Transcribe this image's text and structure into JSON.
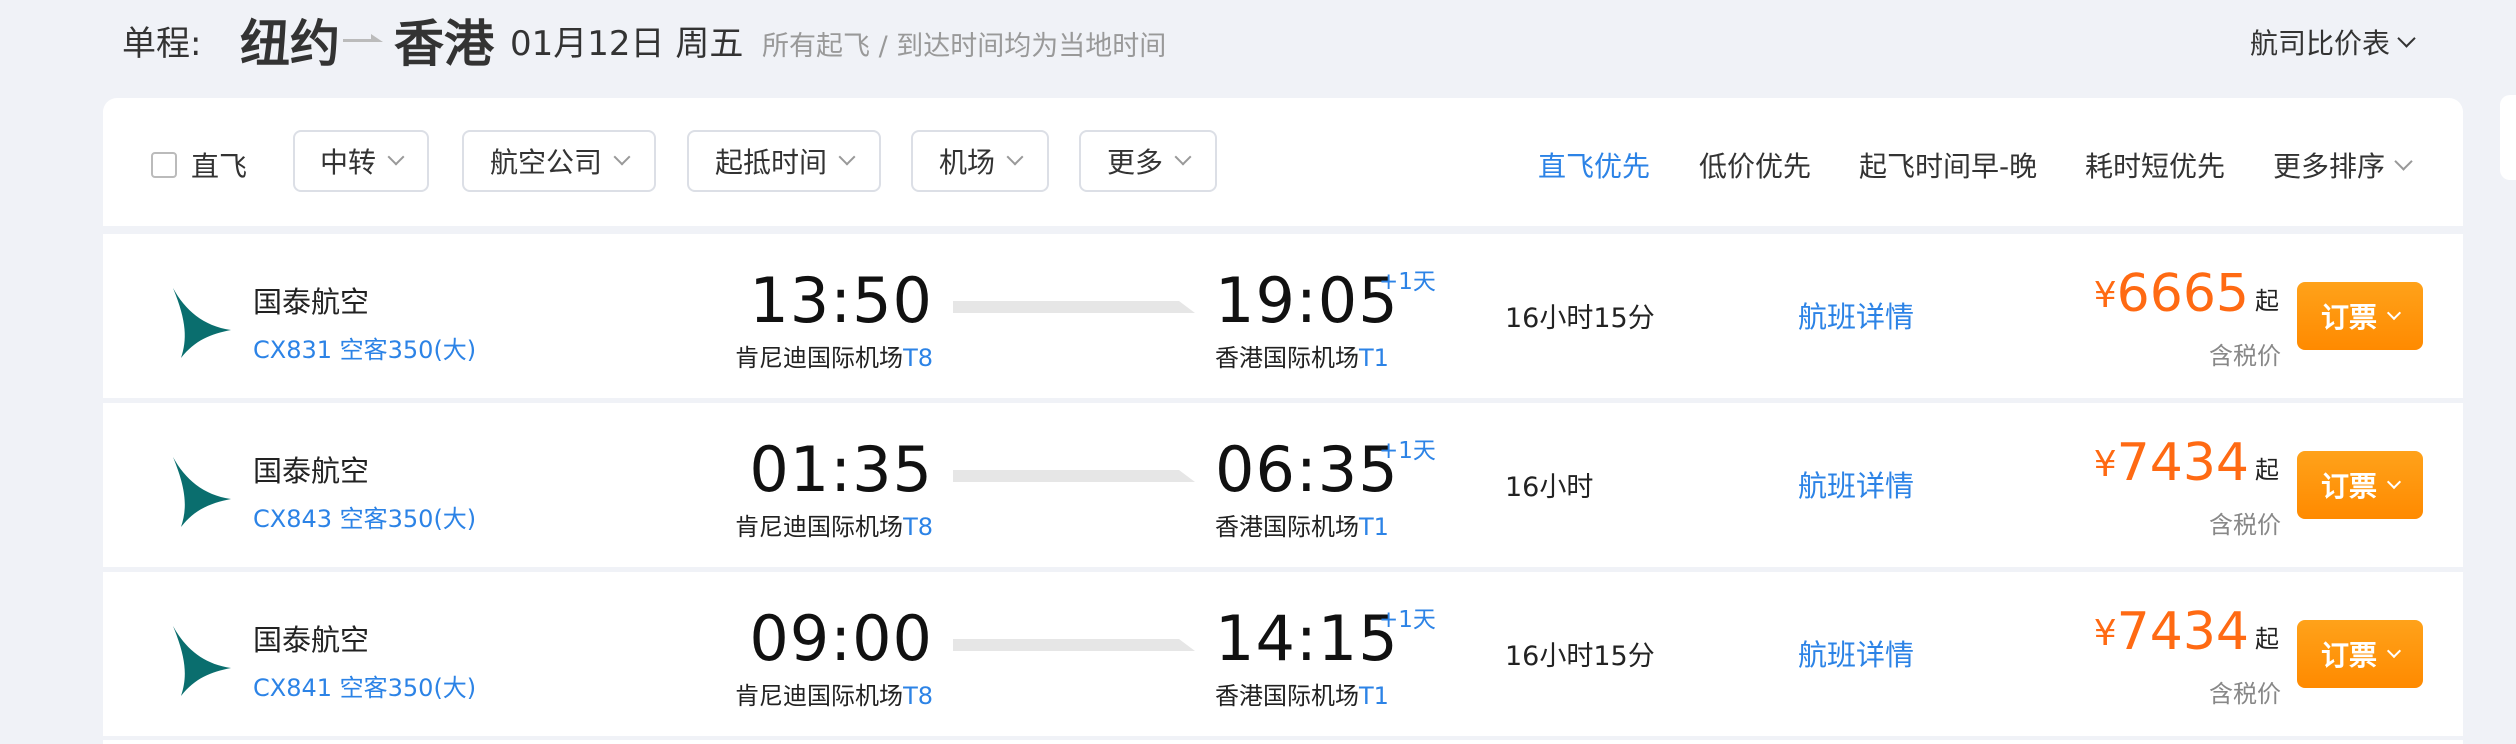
{
  "header": {
    "trip_type": "单程:",
    "from_city": "纽约",
    "to_city": "香港",
    "date": "01月12日 周五",
    "time_note": "所有起飞 / 到达时间均为当地时间",
    "compare_label": "航司比价表"
  },
  "filters": {
    "direct_label": "直飞",
    "direct_checked": false,
    "buttons": [
      "中转",
      "航空公司",
      "起抵时间",
      "机场",
      "更多"
    ]
  },
  "sort": {
    "options": [
      "直飞优先",
      "低价优先",
      "起飞时间早-晚",
      "耗时短优先",
      "更多排序"
    ],
    "active_index": 0
  },
  "flights": [
    {
      "airline": "国泰航空",
      "flight_info": "CX831 空客350(大)",
      "dep_time": "13:50",
      "dep_airport": "肯尼迪国际机场",
      "dep_terminal": "T8",
      "arr_time": "19:05",
      "arr_airport": "香港国际机场",
      "arr_terminal": "T1",
      "next_day": "+1天",
      "duration": "16小时15分",
      "detail_label": "航班详情",
      "currency": "¥",
      "price": "6665",
      "price_suffix": "起",
      "tax_label": "含税价",
      "book_label": "订票"
    },
    {
      "airline": "国泰航空",
      "flight_info": "CX843 空客350(大)",
      "dep_time": "01:35",
      "dep_airport": "肯尼迪国际机场",
      "dep_terminal": "T8",
      "arr_time": "06:35",
      "arr_airport": "香港国际机场",
      "arr_terminal": "T1",
      "next_day": "+1天",
      "duration": "16小时",
      "detail_label": "航班详情",
      "currency": "¥",
      "price": "7434",
      "price_suffix": "起",
      "tax_label": "含税价",
      "book_label": "订票"
    },
    {
      "airline": "国泰航空",
      "flight_info": "CX841 空客350(大)",
      "dep_time": "09:00",
      "dep_airport": "肯尼迪国际机场",
      "dep_terminal": "T8",
      "arr_time": "14:15",
      "arr_airport": "香港国际机场",
      "arr_terminal": "T1",
      "next_day": "+1天",
      "duration": "16小时15分",
      "detail_label": "航班详情",
      "currency": "¥",
      "price": "7434",
      "price_suffix": "起",
      "tax_label": "含税价",
      "book_label": "订票"
    }
  ],
  "icons": {
    "airline_logo": "cathay-pacific-logo-icon",
    "dropdown": "chevron-down-icon",
    "route_arrow": "route-arrow-icon"
  },
  "colors": {
    "accent_blue": "#2c83e6",
    "price_orange": "#ff6a13",
    "book_orange": "#ff9500",
    "logo_teal": "#0a6e6e"
  }
}
